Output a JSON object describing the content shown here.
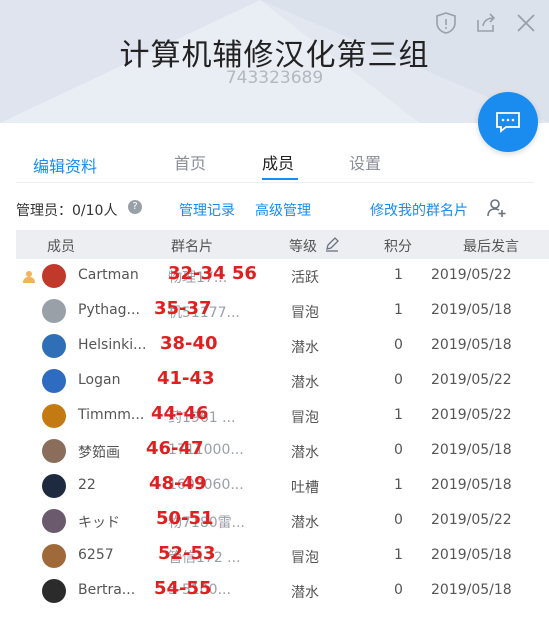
{
  "header": {
    "group_name": "计算机辅修汉化第三组",
    "group_id": "743323689",
    "icons": [
      "shield-icon",
      "share-icon",
      "close-icon"
    ],
    "bg_color": "#e9edf4"
  },
  "chat_button": {
    "icon": "message-icon",
    "color": "#1a8cf0"
  },
  "tabs": [
    {
      "label": "编辑资料"
    },
    {
      "label": "首页"
    },
    {
      "label": "成员",
      "active": true
    },
    {
      "label": "设置"
    }
  ],
  "toolbar": {
    "managers": "管理员：0/10人",
    "help_icon": "?",
    "manage_log": "管理记录",
    "advanced": "高级管理",
    "edit_card": "修改我的群名片",
    "add_icon": "add-member-icon"
  },
  "table": {
    "headers": [
      "成员",
      "群名片",
      "等级",
      "积分",
      "最后发言"
    ],
    "rows": [
      {
        "name": "Cartman",
        "card": "物理17...",
        "level": "活跃",
        "points": "1",
        "date": "2019/05/22",
        "annotation": "32-34  56",
        "owner": true,
        "avatar_color": "#c0392b"
      },
      {
        "name": "Pythag...",
        "card": "机51177...",
        "level": "冒泡",
        "points": "1",
        "date": "2019/05/18",
        "annotation": "35-37",
        "avatar_color": "#9aa0a8"
      },
      {
        "name": "Helsinki...",
        "card": "",
        "level": "潜水",
        "points": "0",
        "date": "2019/05/18",
        "annotation": "38-40",
        "avatar_color": "#2e6fb7"
      },
      {
        "name": "Logan",
        "card": "",
        "level": "潜水",
        "points": "0",
        "date": "2019/05/22",
        "annotation": "41-43",
        "avatar_color": "#2d6cc0"
      },
      {
        "name": "Timmm...",
        "card": "药1961 ...",
        "level": "冒泡",
        "points": "1",
        "date": "2019/05/22",
        "annotation": "44-46",
        "avatar_color": "#c47a12"
      },
      {
        "name": "梦筎画",
        "card": "1711000...",
        "level": "潜水",
        "points": "0",
        "date": "2019/05/18",
        "annotation": "46-47",
        "avatar_color": "#8a6d5a"
      },
      {
        "name": "22",
        "card": "1603060...",
        "level": "吐槽",
        "points": "1",
        "date": "2019/05/18",
        "annotation": "48-49",
        "avatar_color": "#1e2a40"
      },
      {
        "name": "キッド",
        "card": "物7180雷...",
        "level": "潜水",
        "points": "0",
        "date": "2019/05/22",
        "annotation": "50-51",
        "avatar_color": "#6b5a6e"
      },
      {
        "name": "6257",
        "card": "管信172 ...",
        "level": "冒泡",
        "points": "1",
        "date": "2019/05/18",
        "annotation": "52-53",
        "avatar_color": "#a0693a"
      },
      {
        "name": "Bertra...",
        "card": "5-5100...",
        "level": "潜水",
        "points": "0",
        "date": "2019/05/18",
        "annotation": "54-55",
        "avatar_color": "#2b2b2b"
      }
    ]
  },
  "accent": "#1a8cf0",
  "annotation_color": "#e02020"
}
